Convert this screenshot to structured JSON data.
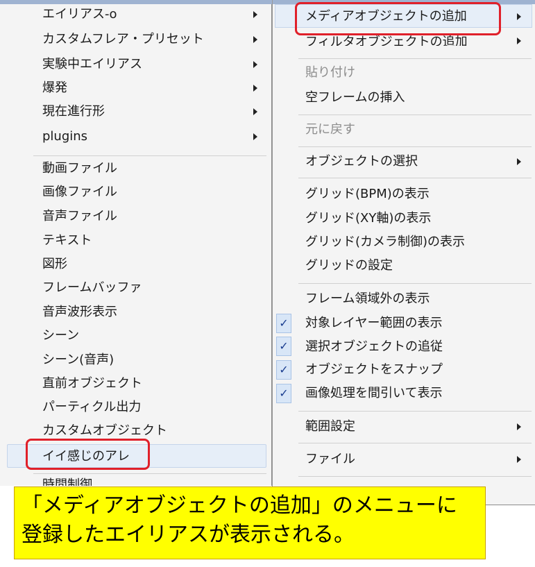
{
  "left_menu": {
    "items": [
      {
        "label": "エイリアス-o",
        "submenu": true
      },
      {
        "label": "カスタムフレア・プリセット",
        "submenu": true
      },
      {
        "label": "実験中エイリアス",
        "submenu": true
      },
      {
        "label": "爆発",
        "submenu": true
      },
      {
        "label": "現在進行形",
        "submenu": true
      },
      {
        "label": "plugins",
        "submenu": true
      },
      {
        "label": "動画ファイル"
      },
      {
        "label": "画像ファイル"
      },
      {
        "label": "音声ファイル"
      },
      {
        "label": "テキスト"
      },
      {
        "label": "図形"
      },
      {
        "label": "フレームバッファ"
      },
      {
        "label": "音声波形表示"
      },
      {
        "label": "シーン"
      },
      {
        "label": "シーン(音声)"
      },
      {
        "label": "直前オブジェクト"
      },
      {
        "label": "パーティクル出力"
      },
      {
        "label": "カスタムオブジェクト"
      },
      {
        "label": "イイ感じのアレ"
      },
      {
        "label": "時間制御"
      }
    ]
  },
  "right_menu": {
    "items": [
      {
        "label": "メディアオブジェクトの追加",
        "submenu": true
      },
      {
        "label": "フィルタオブジェクトの追加",
        "submenu": true
      },
      {
        "label": "貼り付け",
        "disabled": true
      },
      {
        "label": "空フレームの挿入"
      },
      {
        "label": "元に戻す",
        "disabled": true
      },
      {
        "label": "オブジェクトの選択",
        "submenu": true
      },
      {
        "label": "グリッド(BPM)の表示"
      },
      {
        "label": "グリッド(XY軸)の表示"
      },
      {
        "label": "グリッド(カメラ制御)の表示"
      },
      {
        "label": "グリッドの設定"
      },
      {
        "label": "フレーム領域外の表示"
      },
      {
        "label": "対象レイヤー範囲の表示",
        "checked": true
      },
      {
        "label": "選択オブジェクトの追従",
        "checked": true
      },
      {
        "label": "オブジェクトをスナップ",
        "checked": true
      },
      {
        "label": "画像処理を間引いて表示",
        "checked": true
      },
      {
        "label": "範囲設定",
        "submenu": true
      },
      {
        "label": "ファイル",
        "submenu": true
      }
    ]
  },
  "callout": {
    "line1": "「メディアオブジェクトの追加」のメニューに",
    "line2": "登録したエイリアスが表示される。"
  },
  "colors": {
    "highlight_border": "#e0202a",
    "callout_bg": "#ffff00",
    "menu_bg": "#f4f4f4"
  }
}
